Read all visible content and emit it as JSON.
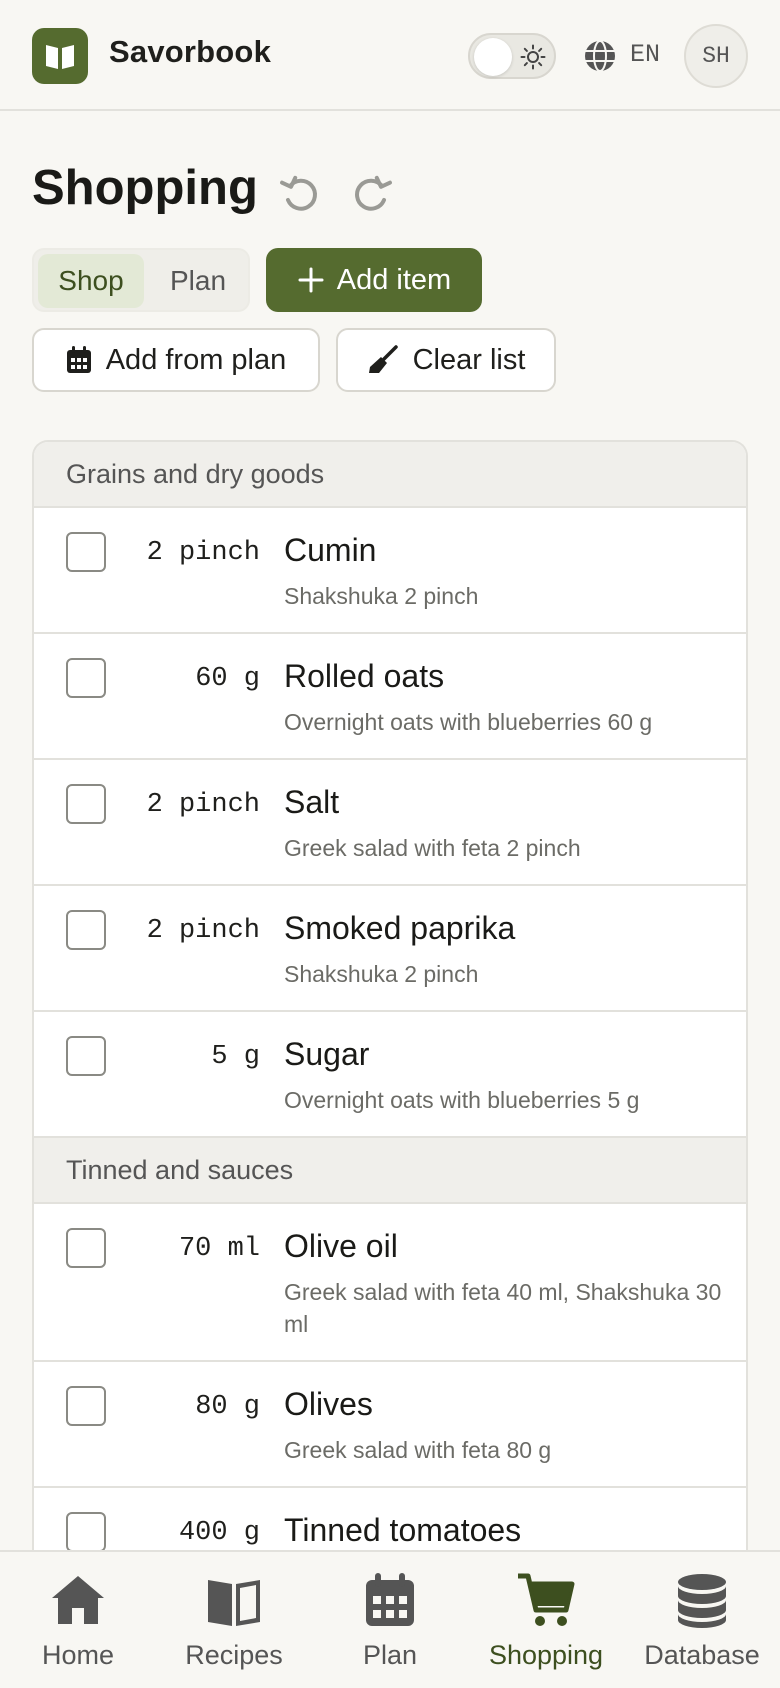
{
  "app": {
    "name": "Savorbook"
  },
  "header": {
    "language": "EN",
    "avatar_initials": "SH"
  },
  "page": {
    "title": "Shopping"
  },
  "mode_tabs": [
    {
      "label": "Shop",
      "selected": true
    },
    {
      "label": "Plan",
      "selected": false
    }
  ],
  "actions": {
    "add_item": "Add item",
    "add_from_plan": "Add from plan",
    "clear_list": "Clear list"
  },
  "groups": [
    {
      "name": "Grains and dry goods",
      "items": [
        {
          "qty": "2 pinch",
          "name": "Cumin",
          "source": "Shakshuka 2 pinch"
        },
        {
          "qty": "60 g",
          "name": "Rolled oats",
          "source": "Overnight oats with blueberries 60 g"
        },
        {
          "qty": "2 pinch",
          "name": "Salt",
          "source": "Greek salad with feta 2 pinch"
        },
        {
          "qty": "2 pinch",
          "name": "Smoked paprika",
          "source": "Shakshuka 2 pinch"
        },
        {
          "qty": "5 g",
          "name": "Sugar",
          "source": "Overnight oats with blueberries 5 g"
        }
      ]
    },
    {
      "name": "Tinned and sauces",
      "items": [
        {
          "qty": "70 ml",
          "name": "Olive oil",
          "source": "Greek salad with feta 40 ml, Shakshuka 30 ml"
        },
        {
          "qty": "80 g",
          "name": "Olives",
          "source": "Greek salad with feta 80 g"
        },
        {
          "qty": "400 g",
          "name": "Tinned tomatoes",
          "source": ""
        }
      ]
    }
  ],
  "nav": [
    {
      "label": "Home",
      "icon": "home-icon",
      "active": false
    },
    {
      "label": "Recipes",
      "icon": "book-icon",
      "active": false
    },
    {
      "label": "Plan",
      "icon": "calendar-icon",
      "active": false
    },
    {
      "label": "Shopping",
      "icon": "cart-icon",
      "active": true
    },
    {
      "label": "Database",
      "icon": "database-icon",
      "active": false
    }
  ],
  "colors": {
    "accent": "#556b2f",
    "background": "#f8f7f3",
    "muted_text": "#6b6b66"
  }
}
